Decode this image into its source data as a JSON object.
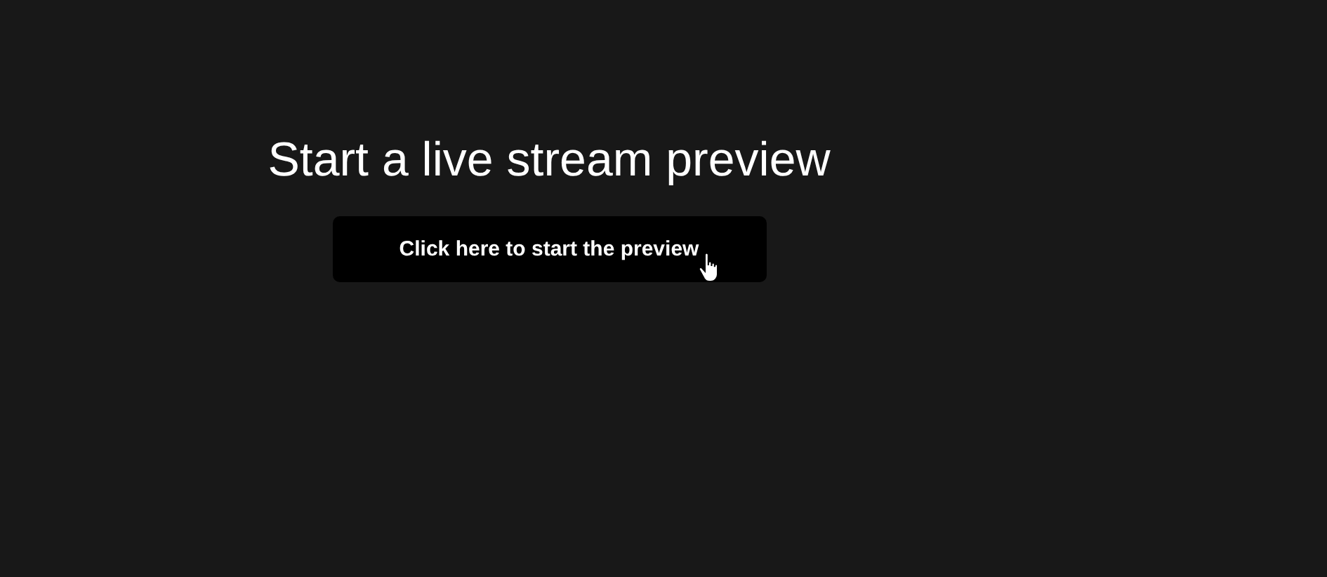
{
  "heading": "Start a live stream preview",
  "button": {
    "label": "Click here to start the preview"
  }
}
